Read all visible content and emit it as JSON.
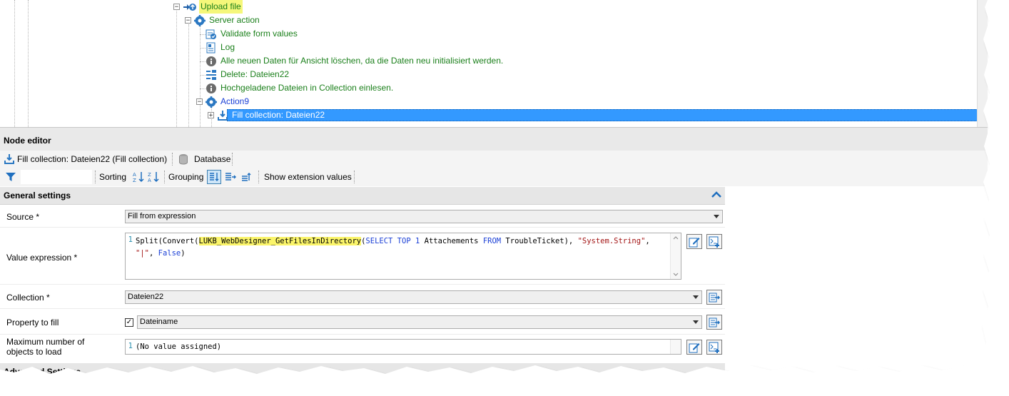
{
  "tree": {
    "nodes": [
      {
        "label": "Upload file"
      },
      {
        "label": "Server action"
      },
      {
        "label": "Validate form values"
      },
      {
        "label": "Log"
      },
      {
        "label": "Alle neuen Daten für Ansicht löschen, da die Daten neu initialisiert werden."
      },
      {
        "label": "Delete: Dateien22"
      },
      {
        "label": "Hochgeladene Dateien in Collection einlesen."
      },
      {
        "label": "Action9"
      },
      {
        "label": "Fill collection: Dateien22"
      }
    ],
    "expander_minus": "−",
    "expander_plus": "+"
  },
  "editor": {
    "title": "Node editor",
    "tabs": [
      {
        "label": "Fill collection: Dateien22 (Fill collection)",
        "icon": "fill-collection-icon"
      },
      {
        "label": "Database",
        "icon": "database-icon"
      }
    ],
    "toolbar": {
      "sorting_label": "Sorting",
      "grouping_label": "Grouping",
      "show_ext_label": "Show extension values"
    }
  },
  "grid": {
    "general_settings": "General settings",
    "advanced_settings": "Advanced Settings",
    "source": {
      "label": "Source *",
      "value": "Fill from expression"
    },
    "value_expression": {
      "label": "Value expression *",
      "line_no": "1",
      "code_parts": {
        "p1": "Split(Convert(",
        "p2": "LUKB_WebDesigner_GetFilesInDirectory",
        "p3": "(",
        "p4": "SELECT TOP ",
        "p5": "1",
        "p6": " Attachements ",
        "p7": "FROM",
        "p8": " TroubleTicket), ",
        "p9": "\"System.String\"",
        "p10": ", ",
        "p11": "\"|\"",
        "p12": ", ",
        "p13": "False",
        "p14": ")"
      }
    },
    "collection": {
      "label": "Collection *",
      "value": "Dateien22"
    },
    "property_to_fill": {
      "label": "Property to fill",
      "checked": "✓",
      "value": "Dateiname"
    },
    "max_objects": {
      "label": "Maximum number of objects to load",
      "line_no": "1",
      "value": "(No value assigned)"
    }
  },
  "colors": {
    "tree_text": "#1a7f1a",
    "selection": "#3399ff",
    "highlight": "#f5f77a",
    "keyword": "#1a3fd6",
    "string": "#a31515"
  }
}
